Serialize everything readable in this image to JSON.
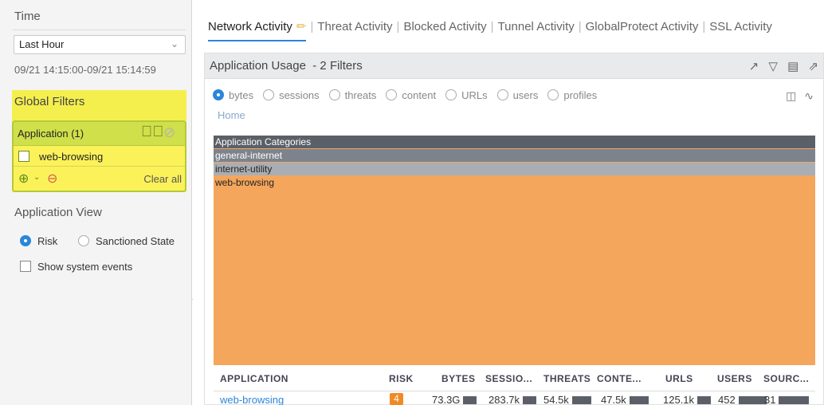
{
  "left_panel": {
    "time_label": "Time",
    "time_select": "Last Hour",
    "time_range": "09/21 14:15:00-09/21 15:14:59",
    "global_filters": {
      "title": "Global Filters",
      "group_label": "Application (1)",
      "item": "web-browsing",
      "clear_all": "Clear all"
    },
    "app_view": {
      "title": "Application View",
      "options": [
        "Risk",
        "Sanctioned State"
      ],
      "selected": "Risk",
      "show_system_events": "Show system events"
    }
  },
  "tabs": [
    "Network Activity",
    "Threat Activity",
    "Blocked Activity",
    "Tunnel Activity",
    "GlobalProtect Activity",
    "SSL Activity"
  ],
  "active_tab": "Network Activity",
  "panel": {
    "title": "Application Usage",
    "filter_count": "- 2 Filters",
    "metrics": [
      "bytes",
      "sessions",
      "threats",
      "content",
      "URLs",
      "users",
      "profiles"
    ],
    "selected_metric": "bytes",
    "home": "Home"
  },
  "treemap": {
    "header": "Application Categories",
    "rows": [
      "general-internet",
      "internet-utility",
      "web-browsing"
    ]
  },
  "table": {
    "columns": [
      "APPLICATION",
      "RISK",
      "BYTES",
      "SESSIO...",
      "THREATS",
      "CONTE...",
      "URLS",
      "USERS",
      "SOURC..."
    ],
    "rows": [
      {
        "application": "web-browsing",
        "risk": "4",
        "bytes": "73.3G",
        "sessions": "283.7k",
        "threats": "54.5k",
        "content": "47.5k",
        "urls": "125.1k",
        "users": "452",
        "sources": "31"
      }
    ]
  },
  "colors": {
    "accent": "#2b86d9",
    "filter_highlight": "#f4ef4d",
    "treemap_web_browsing": "#f4a65c",
    "risk_badge": "#f08a24"
  }
}
